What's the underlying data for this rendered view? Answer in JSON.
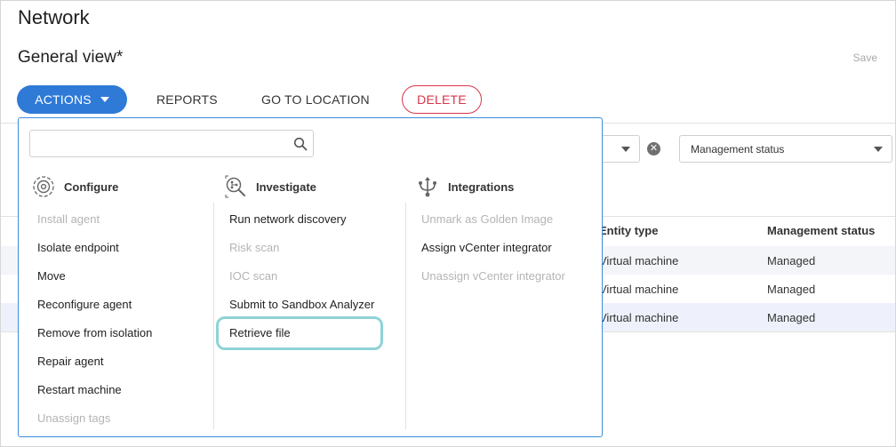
{
  "page": {
    "title": "Network",
    "view_title": "General view*",
    "save_label": "Save"
  },
  "toolbar": {
    "actions_label": "ACTIONS",
    "reports_label": "REPORTS",
    "go_to_location_label": "GO TO LOCATION",
    "delete_label": "DELETE"
  },
  "filters": {
    "management_status": "Management status"
  },
  "table": {
    "headers": {
      "entity_type": "Entity type",
      "management_status": "Management status"
    },
    "rows": [
      {
        "entity_type": "Virtual machine",
        "management_status": "Managed"
      },
      {
        "entity_type": "Virtual machine",
        "management_status": "Managed"
      },
      {
        "entity_type": "Virtual machine",
        "management_status": "Managed"
      }
    ]
  },
  "menu": {
    "search_placeholder": "",
    "columns": [
      {
        "title": "Configure",
        "icon": "gear-icon",
        "items": [
          {
            "label": "Install agent",
            "enabled": false
          },
          {
            "label": "Isolate endpoint",
            "enabled": true
          },
          {
            "label": "Move",
            "enabled": true
          },
          {
            "label": "Reconfigure agent",
            "enabled": true
          },
          {
            "label": "Remove from isolation",
            "enabled": true
          },
          {
            "label": "Repair agent",
            "enabled": true
          },
          {
            "label": "Restart machine",
            "enabled": true
          },
          {
            "label": "Unassign tags",
            "enabled": false
          }
        ]
      },
      {
        "title": "Investigate",
        "icon": "investigate-magnifier-icon",
        "items": [
          {
            "label": "Run network discovery",
            "enabled": true
          },
          {
            "label": "Risk scan",
            "enabled": false
          },
          {
            "label": "IOC scan",
            "enabled": false
          },
          {
            "label": "Submit to Sandbox Analyzer",
            "enabled": true
          },
          {
            "label": "Retrieve file",
            "enabled": true,
            "highlighted": true
          }
        ]
      },
      {
        "title": "Integrations",
        "icon": "integrations-branch-icon",
        "items": [
          {
            "label": "Unmark as Golden Image",
            "enabled": false
          },
          {
            "label": "Assign vCenter integrator",
            "enabled": true
          },
          {
            "label": "Unassign vCenter integrator",
            "enabled": false
          }
        ]
      }
    ]
  },
  "colors": {
    "primary": "#2f7ad6",
    "danger": "#d8354a",
    "highlight": "#8fd3d8",
    "disabled_text": "#b4b4b4",
    "row_stripe": "#f4f5f9"
  }
}
